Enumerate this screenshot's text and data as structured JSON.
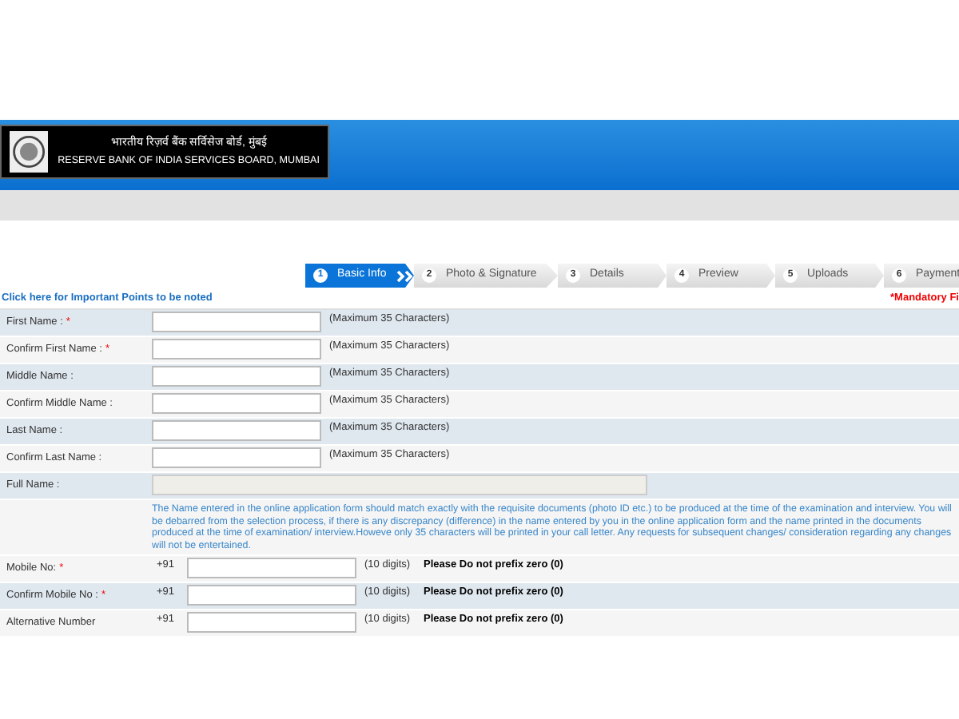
{
  "header": {
    "title_hindi": "भारतीय रिज़र्व बैंक सर्विसेज बोर्ड, मुंबई",
    "title": "RESERVE BANK OF INDIA SERVICES BOARD, MUMBAI"
  },
  "steps": [
    {
      "number": "1",
      "label": "Basic Info",
      "selected": true
    },
    {
      "number": "2",
      "label": "Photo & Signature",
      "selected": false
    },
    {
      "number": "3",
      "label": "Details",
      "selected": false
    },
    {
      "number": "4",
      "label": "Preview",
      "selected": false
    },
    {
      "number": "5",
      "label": "Uploads",
      "selected": false
    },
    {
      "number": "6",
      "label": "Payment",
      "selected": false
    }
  ],
  "important_link": "Click here for Important Points to be noted",
  "mandatory_note": "*Mandatory Fi",
  "rows": [
    {
      "kind": "name",
      "label": "First Name :",
      "required_mark": "*",
      "hint": "(Maximum 35 Characters)"
    },
    {
      "kind": "name",
      "label": "Confirm First Name :",
      "required_mark": "*",
      "hint": "(Maximum 35 Characters)"
    },
    {
      "kind": "name",
      "label": "Middle Name :",
      "hint": "(Maximum 35 Characters)"
    },
    {
      "kind": "name",
      "label": "Confirm Middle Name :",
      "hint": "(Maximum 35 Characters)"
    },
    {
      "kind": "name",
      "label": "Last Name :",
      "hint": "(Maximum 35 Characters)"
    },
    {
      "kind": "name",
      "label": "Confirm Last Name :",
      "hint": "(Maximum 35 Characters)"
    },
    {
      "kind": "full",
      "label": "Full Name :"
    },
    {
      "kind": "note",
      "text": "The Name entered in the online application form should match exactly with the requisite documents (photo ID etc.) to be produced at the time of the examination and interview. You will be debarred from the selection process, if there is any discrepancy (difference) in the name entered by you in the online application form and the name printed in the documents produced at the time of examination/ interview.Howeve only 35 characters will be printed in your call letter. Any requests for subsequent changes/ consideration regarding any changes will not be entertained."
    },
    {
      "kind": "mobile",
      "label": "Mobile No:",
      "required_mark": "*",
      "prefix": "+91",
      "hint": "(10 digits)",
      "warning": "Please Do not prefix zero (0)"
    },
    {
      "kind": "mobile",
      "label": "Confirm Mobile No :",
      "required_mark": "*",
      "prefix": "+91",
      "hint": "(10 digits)",
      "warning": "Please Do not prefix zero (0)"
    },
    {
      "kind": "mobile",
      "label": "Alternative Number",
      "prefix": "+91",
      "hint": "(10 digits)",
      "warning": "Please Do not prefix zero (0)"
    }
  ]
}
